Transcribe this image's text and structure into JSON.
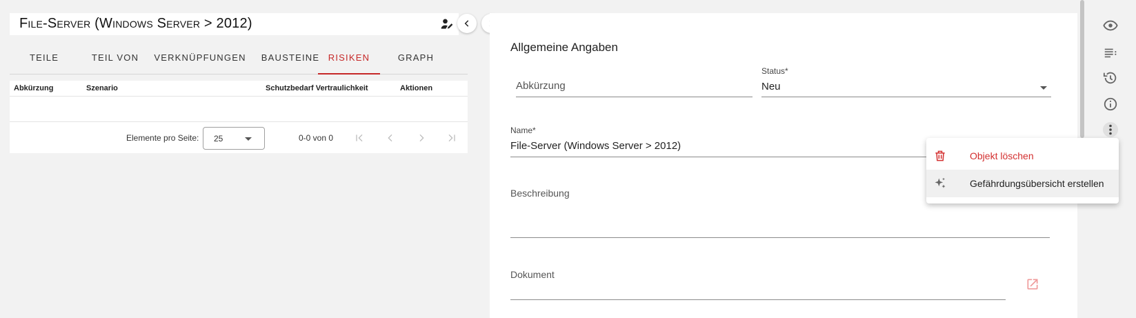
{
  "header": {
    "title": "File-Server (Windows Server > 2012)"
  },
  "tabs": [
    {
      "label": "TEILE",
      "active": false
    },
    {
      "label": "TEIL VON",
      "active": false
    },
    {
      "label": "VERKNÜPFUNGEN",
      "active": false
    },
    {
      "label": "BAUSTEINE",
      "active": false
    },
    {
      "label": "RISIKEN",
      "active": true
    },
    {
      "label": "GRAPH",
      "active": false
    }
  ],
  "table": {
    "columns": [
      "Abkürzung",
      "Szenario",
      "Schutzbedarf Vertraulichkeit",
      "Aktionen"
    ],
    "rows": []
  },
  "pagination": {
    "items_per_page_label": "Elemente pro Seite:",
    "items_per_page_value": "25",
    "range_label": "0-0 von 0"
  },
  "form": {
    "section_title": "Allgemeine Angaben",
    "abbreviation_placeholder": "Abkürzung",
    "status_label": "Status*",
    "status_value": "Neu",
    "name_label": "Name*",
    "name_value": "File-Server (Windows Server > 2012)",
    "description_label": "Beschreibung",
    "document_label": "Dokument"
  },
  "menu": {
    "items": [
      {
        "label": "Objekt löschen",
        "icon": "trash-icon",
        "color": "#d32f2f"
      },
      {
        "label": "Gefährdungsübersicht erstellen",
        "icon": "sparkle-icon",
        "color": "#212121"
      }
    ]
  },
  "toolbar_icons": [
    "eye-icon",
    "list-icon",
    "history-icon",
    "info-icon",
    "more-vertical-icon"
  ],
  "colors": {
    "accent": "#c62828",
    "background": "#f2f2f2"
  }
}
